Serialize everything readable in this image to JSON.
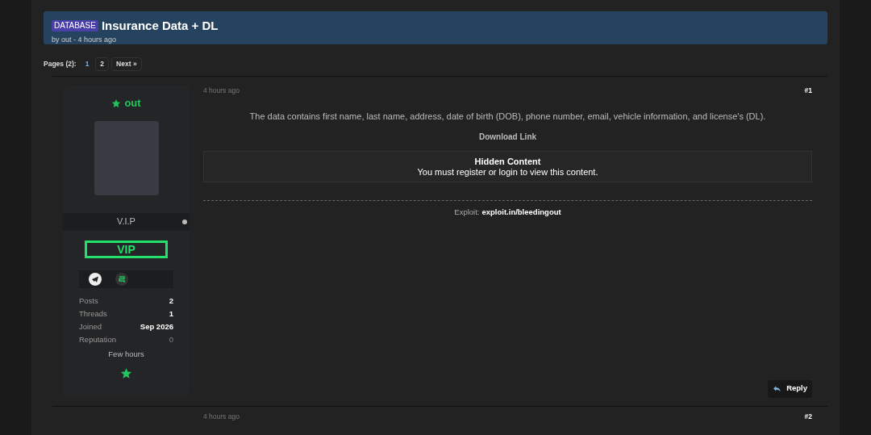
{
  "thread": {
    "prefix": "DATABASE",
    "title": "Insurance Data + DL",
    "byline": "by out - 4 hours ago"
  },
  "pagination": {
    "label": "Pages (2):",
    "pages": [
      {
        "label": "1",
        "selected": true
      },
      {
        "label": "2",
        "selected": false
      }
    ],
    "next": "Next »"
  },
  "posts": [
    {
      "date": "4 hours ago",
      "number": "#1",
      "author": {
        "name": "out",
        "rank": "V.I.P",
        "online": false,
        "badge": "VIP",
        "stats": [
          {
            "label": "Posts",
            "value": "2",
            "muted": false
          },
          {
            "label": "Threads",
            "value": "1",
            "muted": false
          },
          {
            "label": "Joined",
            "value": "Sep 2026",
            "muted": false
          },
          {
            "label": "Reputation",
            "value": "0",
            "muted": true
          }
        ],
        "activity": "Few hours"
      },
      "body": "The data contains first name, last name, address, date of birth (DOB), phone number, email, vehicle information, and license's (DL).",
      "link": "Download Link",
      "hidden": {
        "title": "Hidden Content",
        "text": "You must register or login to view this content."
      },
      "signature": {
        "label": "Exploit:",
        "link": "exploit.in/bleedingout"
      },
      "reply": "Reply"
    },
    {
      "date": "4 hours ago",
      "number": "#2"
    }
  ]
}
